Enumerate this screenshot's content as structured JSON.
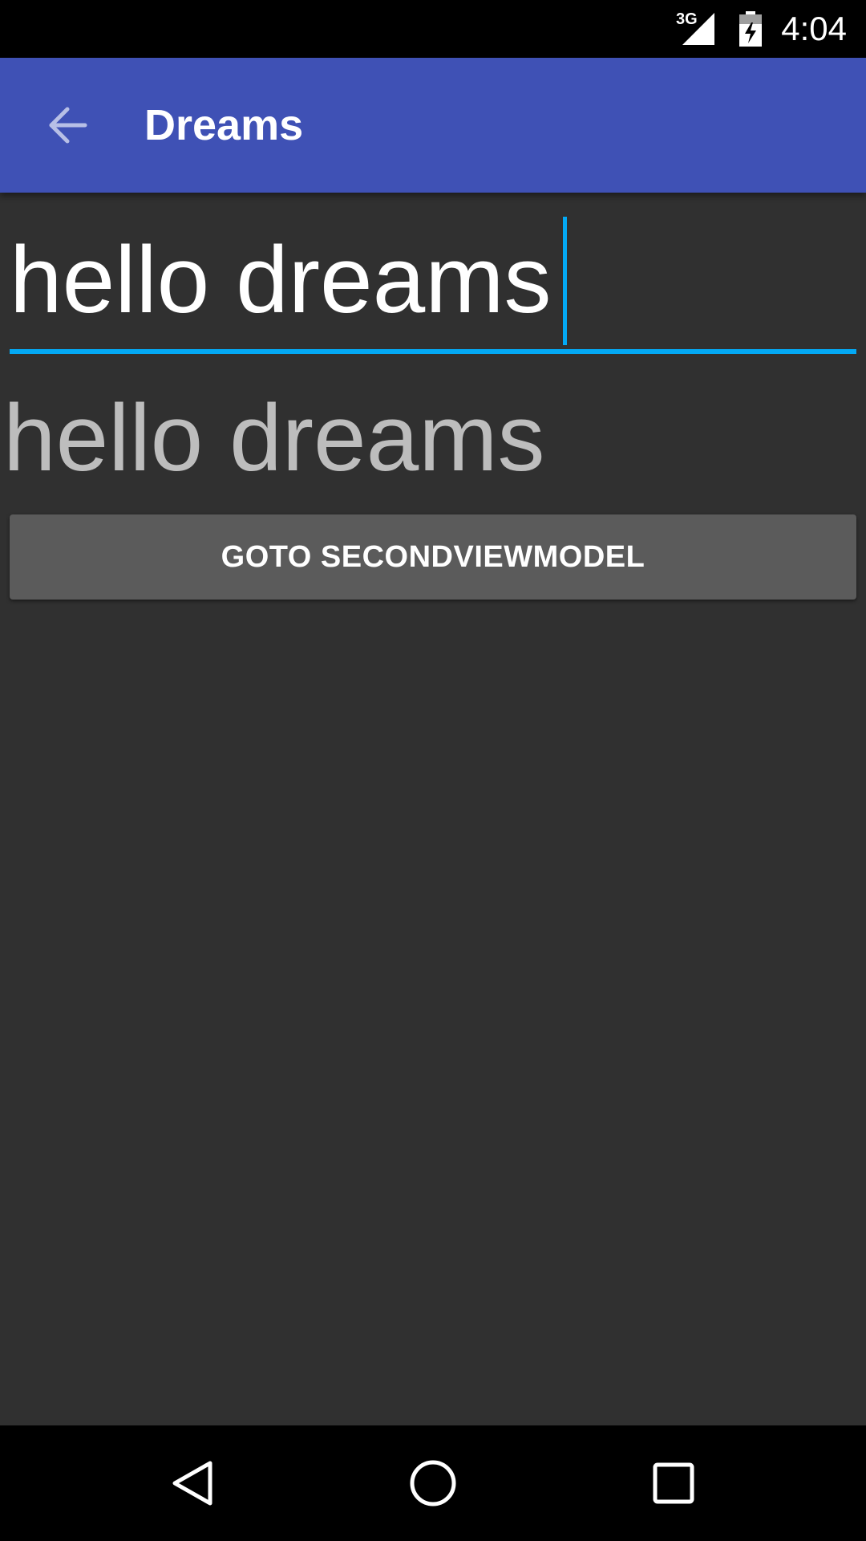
{
  "status_bar": {
    "network": "3G",
    "time": "4:04"
  },
  "toolbar": {
    "title": "Dreams",
    "back_icon": "arrow-back-icon"
  },
  "content": {
    "input_value": "hello dreams",
    "echo_text": "hello dreams",
    "button_label": "GOTO SECONDVIEWMODEL"
  },
  "nav_bar": {
    "back_icon": "nav-back-icon",
    "home_icon": "nav-home-icon",
    "recents_icon": "nav-recents-icon"
  },
  "colors": {
    "primary": "#3f51b5",
    "accent": "#03a9f4",
    "background": "#303030",
    "button": "#5b5b5b"
  }
}
